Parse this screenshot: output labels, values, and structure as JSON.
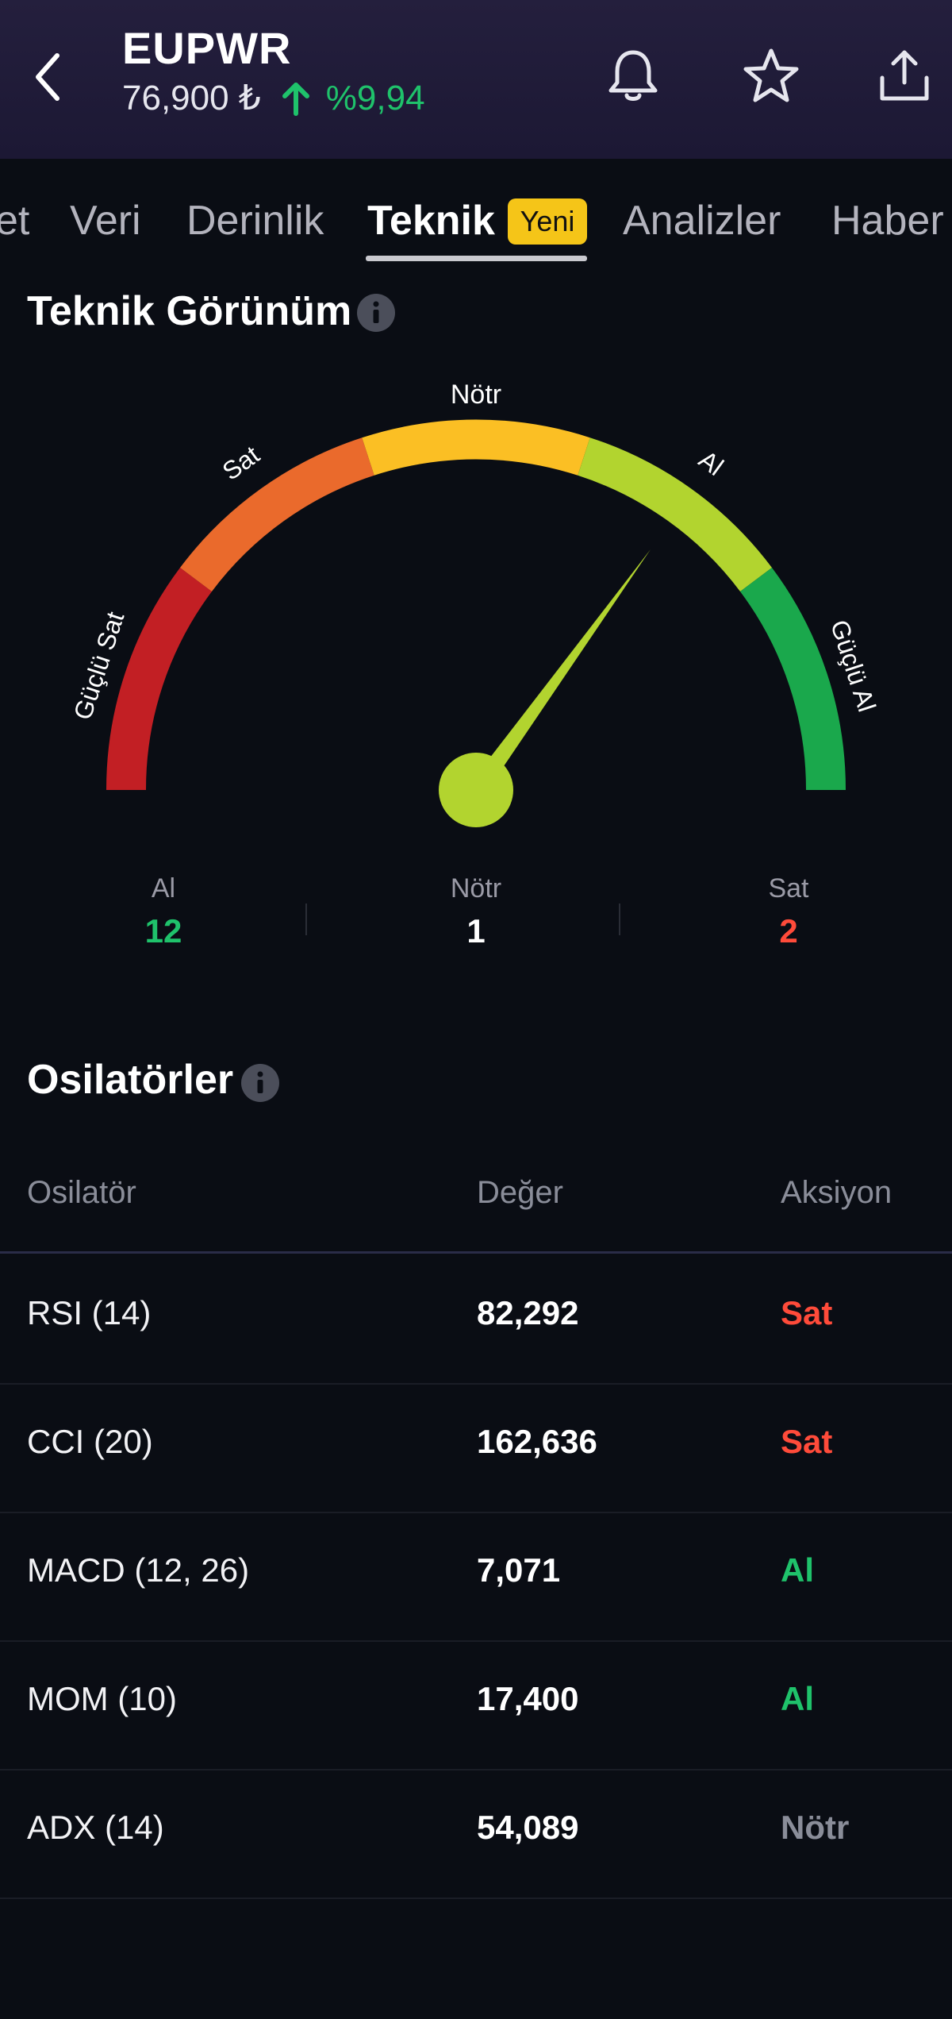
{
  "header": {
    "ticker": "EUPWR",
    "price": "76,900 ₺",
    "change": "%9,94"
  },
  "tabs": [
    "et",
    "Veri",
    "Derinlik",
    "Teknik",
    "Analizler",
    "Haber"
  ],
  "badge": "Yeni",
  "technical": {
    "title": "Teknik Görünüm",
    "gauge": {
      "labels": [
        "Güçlü Sat",
        "Sat",
        "Nötr",
        "Al",
        "Güçlü Al"
      ],
      "needle_label": "Al",
      "colors": {
        "strong_sell": "#c21f24",
        "sell": "#ea6a2c",
        "neutral": "#fbbf24",
        "buy": "#b2d42f",
        "strong_buy": "#1aa84c"
      }
    },
    "summary": [
      {
        "label": "Al",
        "value": "12",
        "color": "#1fc26b"
      },
      {
        "label": "Nötr",
        "value": "1",
        "color": "#ffffff"
      },
      {
        "label": "Sat",
        "value": "2",
        "color": "#ff4b3a"
      }
    ]
  },
  "oscillators": {
    "title": "Osilatörler",
    "columns": [
      "Osilatör",
      "Değer",
      "Aksiyon"
    ],
    "rows": [
      {
        "name": "RSI (14)",
        "value": "82,292",
        "action": "Sat",
        "color": "#ff4b3a"
      },
      {
        "name": "CCI (20)",
        "value": "162,636",
        "action": "Sat",
        "color": "#ff4b3a"
      },
      {
        "name": "MACD (12, 26)",
        "value": "7,071",
        "action": "Al",
        "color": "#1fc26b"
      },
      {
        "name": "MOM (10)",
        "value": "17,400",
        "action": "Al",
        "color": "#1fc26b"
      },
      {
        "name": "ADX (14)",
        "value": "54,089",
        "action": "Nötr",
        "color": "#8a8d99"
      }
    ]
  }
}
